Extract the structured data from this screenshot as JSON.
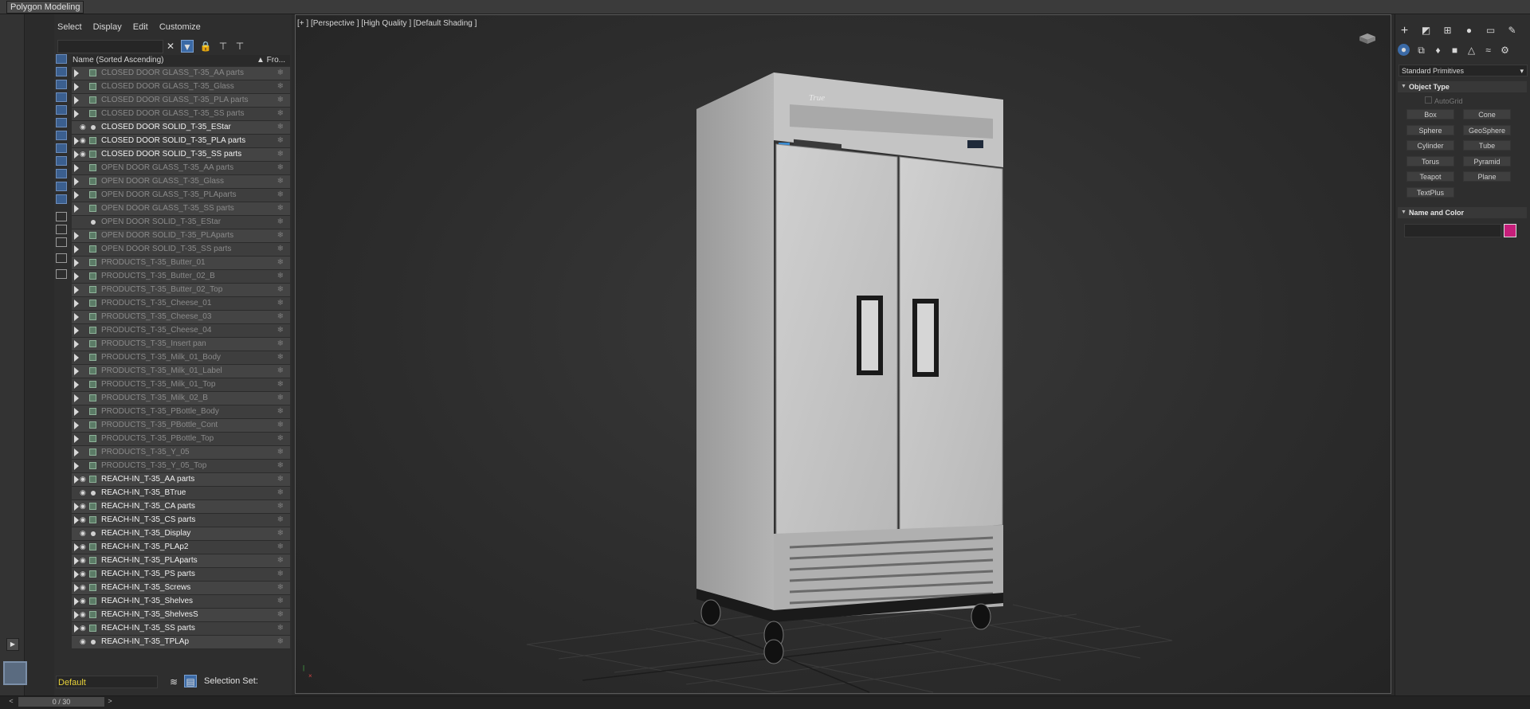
{
  "ribbon": {
    "tab_label": "Polygon Modeling"
  },
  "explorer": {
    "menu": [
      "Select",
      "Display",
      "Edit",
      "Customize"
    ],
    "search": {
      "value": ""
    },
    "column_name": "Name (Sorted Ascending)",
    "column_frozen": "▲ Fro...",
    "rows": [
      {
        "name": "CLOSED DOOR GLASS_T-35_AA parts",
        "hidden": true,
        "kind": "group"
      },
      {
        "name": "CLOSED DOOR GLASS_T-35_Glass",
        "hidden": true,
        "kind": "group"
      },
      {
        "name": "CLOSED DOOR GLASS_T-35_PLA parts",
        "hidden": true,
        "kind": "group"
      },
      {
        "name": "CLOSED DOOR GLASS_T-35_SS parts",
        "hidden": true,
        "kind": "group"
      },
      {
        "name": "CLOSED DOOR SOLID_T-35_EStar",
        "hidden": false,
        "kind": "object"
      },
      {
        "name": "CLOSED DOOR SOLID_T-35_PLA parts",
        "hidden": false,
        "kind": "group"
      },
      {
        "name": "CLOSED DOOR SOLID_T-35_SS parts",
        "hidden": false,
        "kind": "group"
      },
      {
        "name": "OPEN DOOR GLASS_T-35_AA parts",
        "hidden": true,
        "kind": "group"
      },
      {
        "name": "OPEN DOOR GLASS_T-35_Glass",
        "hidden": true,
        "kind": "group"
      },
      {
        "name": "OPEN DOOR GLASS_T-35_PLAparts",
        "hidden": true,
        "kind": "group"
      },
      {
        "name": "OPEN DOOR GLASS_T-35_SS parts",
        "hidden": true,
        "kind": "group"
      },
      {
        "name": "OPEN DOOR SOLID_T-35_EStar",
        "hidden": true,
        "kind": "object"
      },
      {
        "name": "OPEN DOOR SOLID_T-35_PLAparts",
        "hidden": true,
        "kind": "group"
      },
      {
        "name": "OPEN DOOR SOLID_T-35_SS parts",
        "hidden": true,
        "kind": "group"
      },
      {
        "name": "PRODUCTS_T-35_Butter_01",
        "hidden": true,
        "kind": "group"
      },
      {
        "name": "PRODUCTS_T-35_Butter_02_B",
        "hidden": true,
        "kind": "group"
      },
      {
        "name": "PRODUCTS_T-35_Butter_02_Top",
        "hidden": true,
        "kind": "group"
      },
      {
        "name": "PRODUCTS_T-35_Cheese_01",
        "hidden": true,
        "kind": "group"
      },
      {
        "name": "PRODUCTS_T-35_Cheese_03",
        "hidden": true,
        "kind": "group"
      },
      {
        "name": "PRODUCTS_T-35_Cheese_04",
        "hidden": true,
        "kind": "group"
      },
      {
        "name": "PRODUCTS_T-35_Insert pan",
        "hidden": true,
        "kind": "group"
      },
      {
        "name": "PRODUCTS_T-35_Milk_01_Body",
        "hidden": true,
        "kind": "group"
      },
      {
        "name": "PRODUCTS_T-35_Milk_01_Label",
        "hidden": true,
        "kind": "group"
      },
      {
        "name": "PRODUCTS_T-35_Milk_01_Top",
        "hidden": true,
        "kind": "group"
      },
      {
        "name": "PRODUCTS_T-35_Milk_02_B",
        "hidden": true,
        "kind": "group"
      },
      {
        "name": "PRODUCTS_T-35_PBottle_Body",
        "hidden": true,
        "kind": "group"
      },
      {
        "name": "PRODUCTS_T-35_PBottle_Cont",
        "hidden": true,
        "kind": "group"
      },
      {
        "name": "PRODUCTS_T-35_PBottle_Top",
        "hidden": true,
        "kind": "group"
      },
      {
        "name": "PRODUCTS_T-35_Y_05",
        "hidden": true,
        "kind": "group"
      },
      {
        "name": "PRODUCTS_T-35_Y_05_Top",
        "hidden": true,
        "kind": "group"
      },
      {
        "name": "REACH-IN_T-35_AA parts",
        "hidden": false,
        "kind": "group"
      },
      {
        "name": "REACH-IN_T-35_BTrue",
        "hidden": false,
        "kind": "object"
      },
      {
        "name": "REACH-IN_T-35_CA parts",
        "hidden": false,
        "kind": "group"
      },
      {
        "name": "REACH-IN_T-35_CS parts",
        "hidden": false,
        "kind": "group"
      },
      {
        "name": "REACH-IN_T-35_Display",
        "hidden": false,
        "kind": "object"
      },
      {
        "name": "REACH-IN_T-35_PLAp2",
        "hidden": false,
        "kind": "group"
      },
      {
        "name": "REACH-IN_T-35_PLAparts",
        "hidden": false,
        "kind": "group"
      },
      {
        "name": "REACH-IN_T-35_PS parts",
        "hidden": false,
        "kind": "group"
      },
      {
        "name": "REACH-IN_T-35_Screws",
        "hidden": false,
        "kind": "group"
      },
      {
        "name": "REACH-IN_T-35_Shelves",
        "hidden": false,
        "kind": "group"
      },
      {
        "name": "REACH-IN_T-35_ShelvesS",
        "hidden": false,
        "kind": "group"
      },
      {
        "name": "REACH-IN_T-35_SS parts",
        "hidden": false,
        "kind": "group"
      },
      {
        "name": "REACH-IN_T-35_TPLAp",
        "hidden": false,
        "kind": "object"
      }
    ],
    "layer_value": "Default",
    "selection_set_label": "Selection Set:"
  },
  "timeline": {
    "frame_label": "0 / 30"
  },
  "viewport": {
    "label": "[+ ]  [Perspective ]  [High Quality ]  [Default Shading ]",
    "fridge_logo": "True"
  },
  "command_panel": {
    "category": "Standard Primitives",
    "object_type_title": "Object Type",
    "autogrid_label": "AutoGrid",
    "primitives": [
      "Box",
      "Cone",
      "Sphere",
      "GeoSphere",
      "Cylinder",
      "Tube",
      "Torus",
      "Pyramid",
      "Teapot",
      "Plane",
      "TextPlus"
    ],
    "name_color_title": "Name and Color",
    "object_name": "",
    "object_color": "#c61e7a"
  }
}
